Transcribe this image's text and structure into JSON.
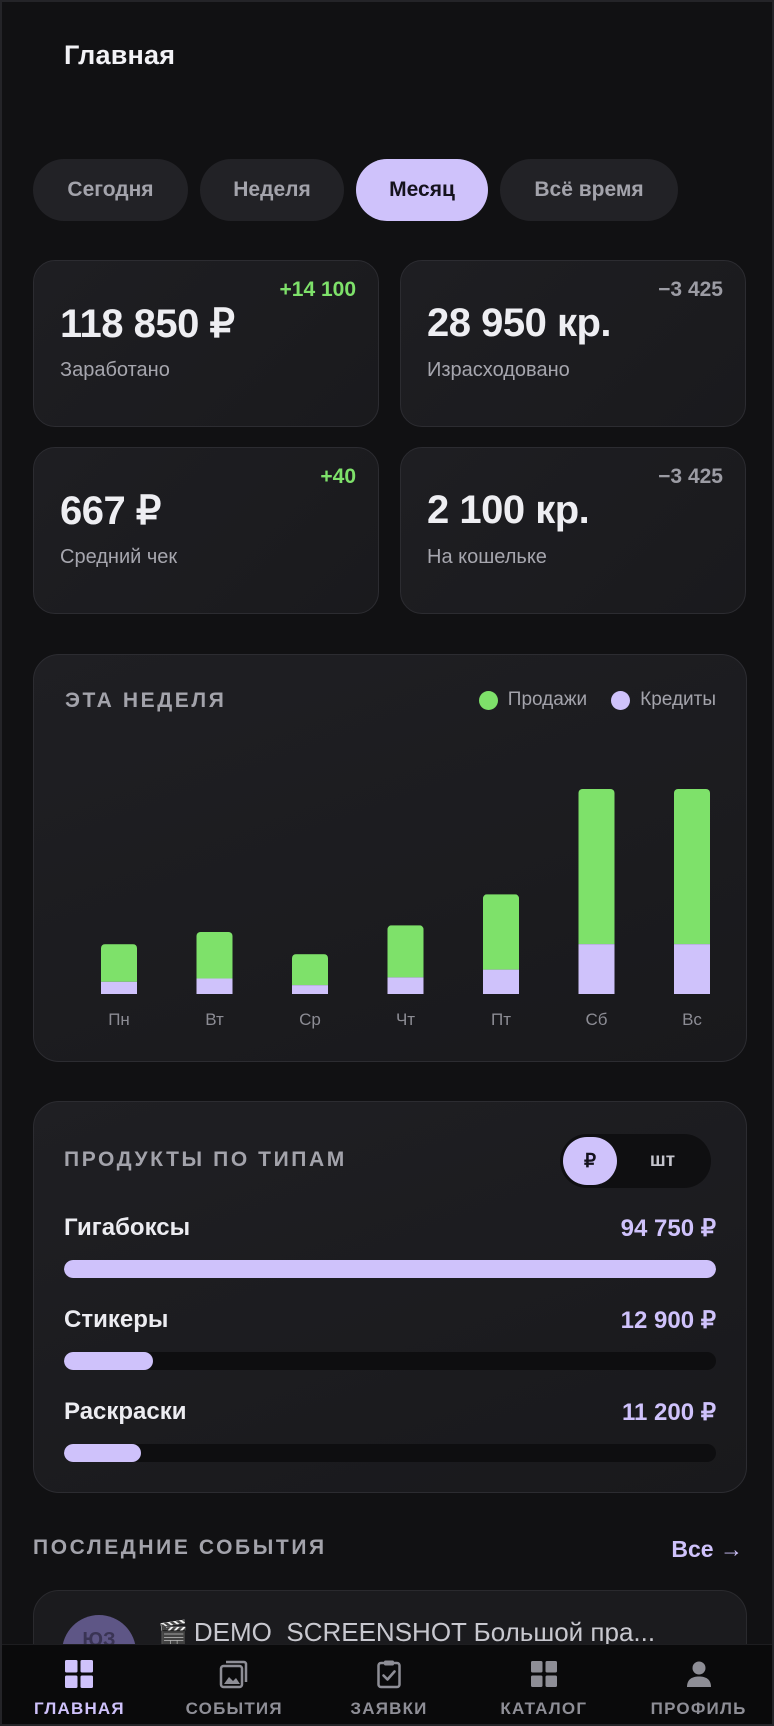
{
  "header": {
    "title": "Главная"
  },
  "period_tabs": [
    {
      "label": "Сегодня",
      "active": false
    },
    {
      "label": "Неделя",
      "active": false
    },
    {
      "label": "Месяц",
      "active": true
    },
    {
      "label": "Всё время",
      "active": false
    }
  ],
  "stats": [
    {
      "value": "118 850 ₽",
      "label": "Заработано",
      "delta": "+14 100",
      "delta_sign": "positive"
    },
    {
      "value": "28 950 кр.",
      "label": "Израсходовано",
      "delta": "−3 425",
      "delta_sign": "negative"
    },
    {
      "value": "667 ₽",
      "label": "Средний чек",
      "delta": "+40",
      "delta_sign": "positive"
    },
    {
      "value": "2 100 кр.",
      "label": "На кошельке",
      "delta": "−3 425",
      "delta_sign": "negative"
    }
  ],
  "weekly_chart": {
    "title": "ЭТА НЕДЕЛЯ",
    "legend": [
      "Продажи",
      "Кредиты"
    ]
  },
  "chart_data": {
    "type": "bar",
    "stacked": true,
    "title": "ЭТА НЕДЕЛЯ",
    "categories": [
      "Пн",
      "Вт",
      "Ср",
      "Чт",
      "Пт",
      "Сб",
      "Вс"
    ],
    "series": [
      {
        "name": "Кредиты",
        "color": "#cfc2fb",
        "values": [
          11,
          14,
          8,
          15,
          22,
          45,
          45
        ]
      },
      {
        "name": "Продажи",
        "color": "#7ee16a",
        "values": [
          34,
          42,
          28,
          47,
          68,
          140,
          140
        ]
      }
    ],
    "ylim": [
      0,
      185
    ],
    "grid": false,
    "legend_position": "top-right"
  },
  "products": {
    "title": "ПРОДУКТЫ ПО ТИПАМ",
    "toggle": [
      {
        "label": "₽",
        "active": true
      },
      {
        "label": "шт",
        "active": false
      }
    ],
    "items": [
      {
        "name": "Гигабоксы",
        "value": "94 750 ₽",
        "amount": 94750
      },
      {
        "name": "Стикеры",
        "value": "12 900 ₽",
        "amount": 12900
      },
      {
        "name": "Раскраски",
        "value": "11 200 ₽",
        "amount": 11200
      }
    ],
    "max_amount": 94750
  },
  "events": {
    "title": "ПОСЛЕДНИЕ СОБЫТИЯ",
    "all_link": "Все →",
    "items": [
      {
        "avatar_text": "ЮЗ",
        "icon": "clapperboard-icon",
        "title": "DEMO_SCREENSHOT Большой пра..."
      }
    ]
  },
  "bottom_nav": [
    {
      "label": "ГЛАВНАЯ",
      "icon": "grid-icon",
      "active": true
    },
    {
      "label": "СОБЫТИЯ",
      "icon": "images-icon",
      "active": false
    },
    {
      "label": "ЗАЯВКИ",
      "icon": "clipboard-check-icon",
      "active": false
    },
    {
      "label": "КАТАЛОГ",
      "icon": "catalog-grid-icon",
      "active": false
    },
    {
      "label": "ПРОФИЛЬ",
      "icon": "person-icon",
      "active": false
    }
  ],
  "colors": {
    "accent": "#cfc2fb",
    "positive": "#7ee16a",
    "background": "#111113"
  }
}
